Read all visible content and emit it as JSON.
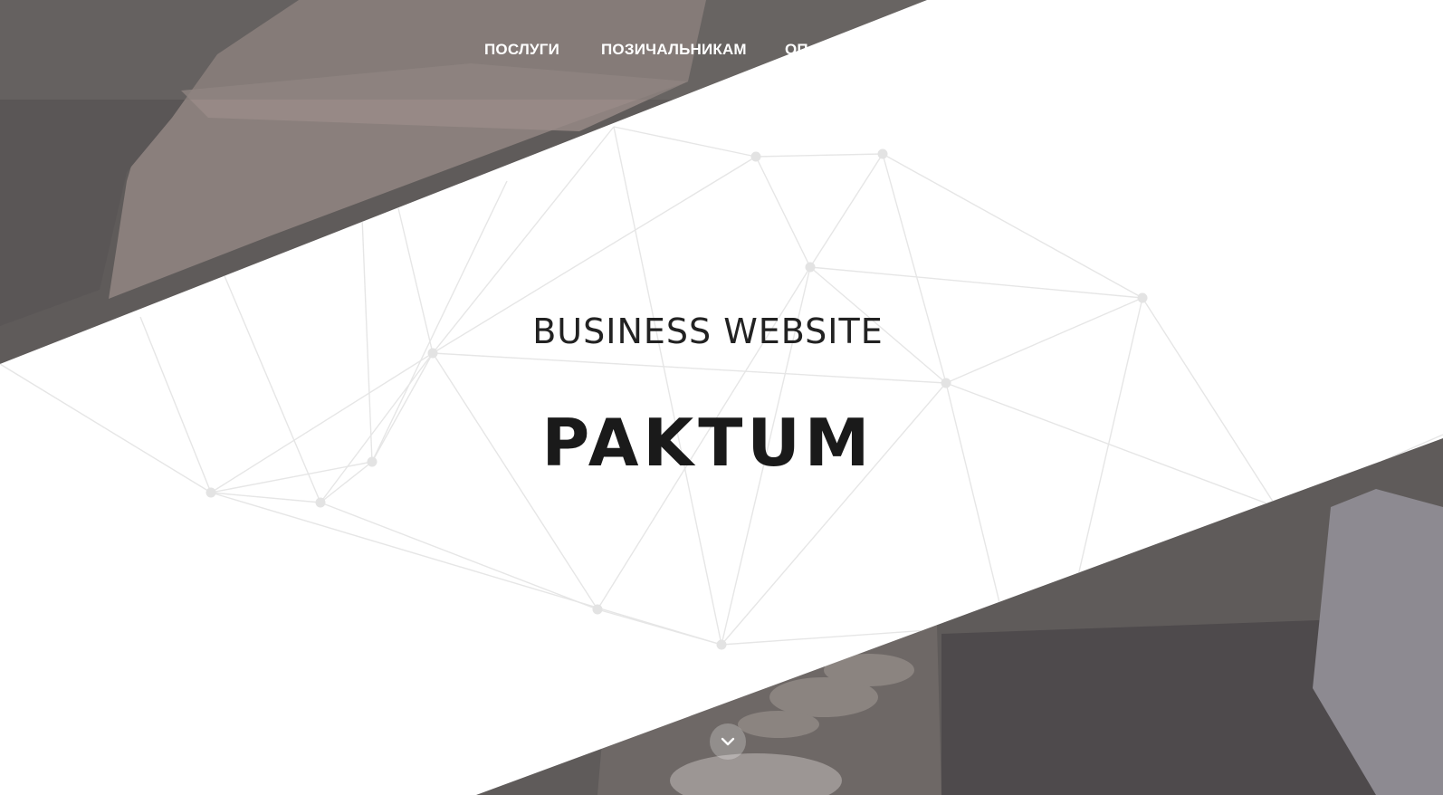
{
  "nav": {
    "items": [
      {
        "label": "ПОСЛУГИ"
      },
      {
        "label": "ПОЗИЧАЛЬНИКАМ"
      },
      {
        "label": "ОП"
      }
    ]
  },
  "hero": {
    "subtitle": "BUSINESS WEBSITE",
    "title": "PAKTUM"
  },
  "scroll_button": {
    "icon": "chevron-down-icon"
  },
  "colors": {
    "overlay": "#66615f",
    "text_dark": "#1a1a1a",
    "nav_text": "#ffffff"
  }
}
